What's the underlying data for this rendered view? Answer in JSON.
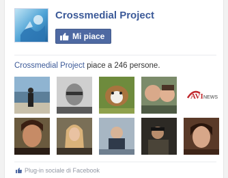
{
  "page": {
    "name": "Crossmedial Project",
    "like_button_label": "Mi piace"
  },
  "social": {
    "page_link": "Crossmedial Project",
    "likes_text": " piace a 246 persone."
  },
  "faces": [
    {
      "name": "fan-photo-1",
      "kind": "photo",
      "bg": "#5f86a8"
    },
    {
      "name": "fan-photo-2",
      "kind": "photo",
      "bg": "#9a9a9a"
    },
    {
      "name": "fan-photo-3",
      "kind": "photo",
      "bg": "#6b7b3a"
    },
    {
      "name": "fan-photo-4",
      "kind": "photo",
      "bg": "#8a6f5c"
    },
    {
      "name": "fan-logo-avinews",
      "kind": "logo",
      "bg": "#ffffff",
      "label": "AVINEWS"
    },
    {
      "name": "fan-photo-6",
      "kind": "photo",
      "bg": "#9c6a4c"
    },
    {
      "name": "fan-photo-7",
      "kind": "photo",
      "bg": "#b8936d"
    },
    {
      "name": "fan-photo-8",
      "kind": "photo",
      "bg": "#7f8d99"
    },
    {
      "name": "fan-photo-9",
      "kind": "photo",
      "bg": "#3f3a33"
    },
    {
      "name": "fan-photo-10",
      "kind": "photo",
      "bg": "#6b4632"
    }
  ],
  "footer": {
    "text": "Plug-in sociale di Facebook"
  },
  "colors": {
    "facebook_blue": "#3b5998",
    "button_blue": "#4e69a2"
  },
  "icons": {
    "like": "thumbs-up-icon",
    "footer": "facebook-thumb-icon"
  }
}
